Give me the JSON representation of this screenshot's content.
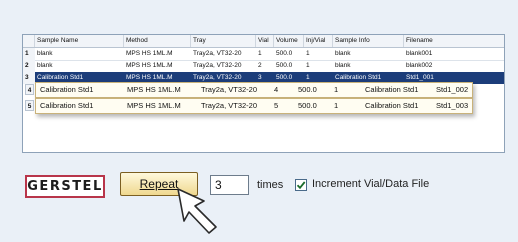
{
  "table": {
    "columns": [
      "Sample Name",
      "Method",
      "Tray",
      "Vial",
      "Volume",
      "Inj/Vial",
      "Sample Info",
      "Filename"
    ],
    "rows": [
      {
        "num": "1",
        "cells": [
          "blank",
          "MPS HS 1ML.M",
          "Tray2a, VT32-20",
          "1",
          "500.0",
          "1",
          "blank",
          "blank001"
        ]
      },
      {
        "num": "2",
        "cells": [
          "blank",
          "MPS HS 1ML.M",
          "Tray2a, VT32-20",
          "2",
          "500.0",
          "1",
          "blank",
          "blank002"
        ]
      },
      {
        "num": "3",
        "cells": [
          "Calibration Std1",
          "MPS HS 1ML.M",
          "Tray2a, VT32-20",
          "3",
          "500.0",
          "1",
          "Calibration Std1",
          "Std1_001"
        ]
      }
    ],
    "new_rows": [
      {
        "num": "4",
        "cells": [
          "Calibration Std1",
          "MPS HS 1ML.M",
          "Tray2a, VT32-20",
          "4",
          "500.0",
          "1",
          "Calibration Std1",
          "Std1_002"
        ]
      },
      {
        "num": "5",
        "cells": [
          "Calibration Std1",
          "MPS HS 1ML.M",
          "Tray2a, VT32-20",
          "5",
          "500.0",
          "1",
          "Calibration Std1",
          "Std1_003"
        ]
      }
    ]
  },
  "logo_text": "GERSTEL",
  "repeat_button_label": "Repeat",
  "repeat_count": "3",
  "times_label": "times",
  "increment_checked": true,
  "increment_label": "Increment Vial/Data File",
  "colors": {
    "selection": "#1c3d7a",
    "logo_border": "#b8354a"
  }
}
